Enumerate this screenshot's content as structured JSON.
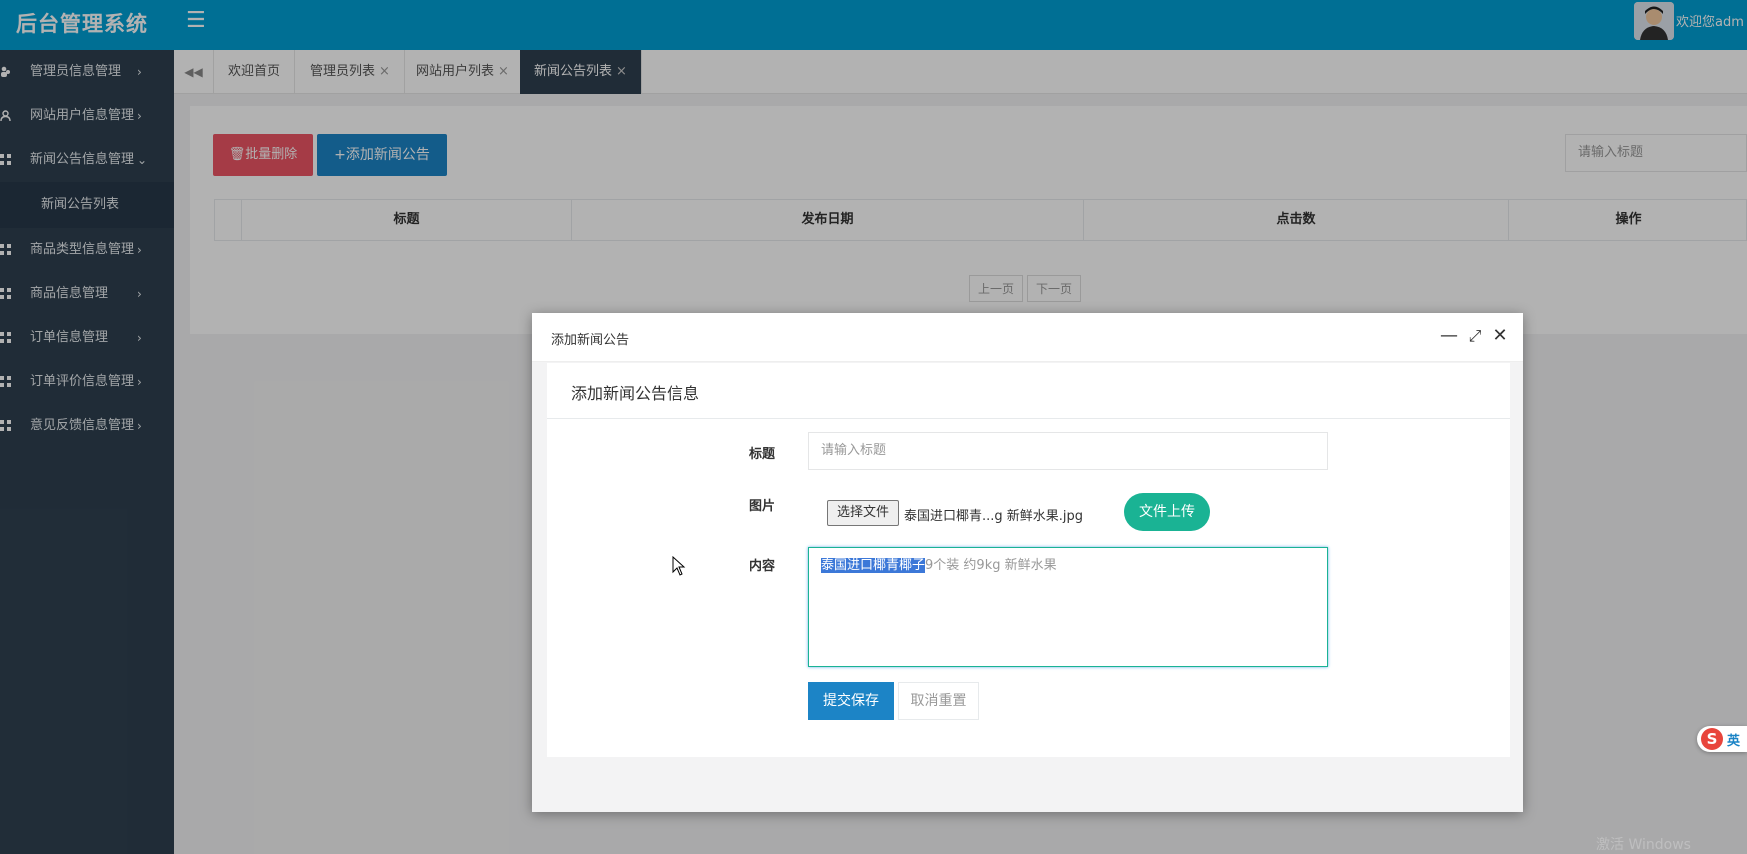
{
  "topbar": {
    "brand": "后台管理系统",
    "menu_icon": "☰",
    "welcome": "欢迎您adm"
  },
  "sidebar": {
    "items": [
      {
        "label": "管理员信息管理",
        "arrow": "›",
        "icon": "users-icon"
      },
      {
        "label": "网站用户信息管理",
        "arrow": "›",
        "icon": "user-icon"
      },
      {
        "label": "新闻公告信息管理",
        "arrow": "⌄",
        "icon": "grid-icon"
      },
      {
        "label": "新闻公告列表",
        "sub": true
      },
      {
        "label": "商品类型信息管理",
        "arrow": "›",
        "icon": "grid-icon"
      },
      {
        "label": "商品信息管理",
        "arrow": "›",
        "icon": "grid-icon"
      },
      {
        "label": "订单信息管理",
        "arrow": "›",
        "icon": "grid-icon"
      },
      {
        "label": "订单评价信息管理",
        "arrow": "›",
        "icon": "grid-icon"
      },
      {
        "label": "意见反馈信息管理",
        "arrow": "›",
        "icon": "grid-icon"
      }
    ]
  },
  "tabs": {
    "back_icon": "◀◀",
    "items": [
      {
        "label": "欢迎首页",
        "close": ""
      },
      {
        "label": "管理员列表",
        "close": "×"
      },
      {
        "label": "网站用户列表",
        "close": "×"
      },
      {
        "label": "新闻公告列表",
        "close": "×",
        "active": true
      }
    ]
  },
  "toolbar": {
    "batch_delete": "批量删除",
    "add_news": "+添加新闻公告",
    "search_placeholder": "请输入标题"
  },
  "table": {
    "columns": [
      "标题",
      "发布日期",
      "点击数",
      "操作"
    ]
  },
  "pager": {
    "prev": "上一页",
    "next": "下一页"
  },
  "modal": {
    "title": "添加新闻公告",
    "minimize": "—",
    "maximize": "⤢",
    "close": "✕",
    "form_title": "添加新闻公告信息",
    "title_label": "标题",
    "title_placeholder": "请输入标题",
    "image_label": "图片",
    "choose_file": "选择文件",
    "file_name": "泰国进口椰青...g 新鲜水果.jpg",
    "upload": "文件上传",
    "content_label": "内容",
    "content_selected": "泰国进口椰青椰子",
    "content_rest": "9个装 约9kg 新鲜水果",
    "submit": "提交保存",
    "reset": "取消重置"
  },
  "ime": {
    "logo": "S",
    "lang": "英"
  },
  "watermark": "激活 Windows",
  "colors": {
    "topbar": "#009fd5",
    "sidebar": "#2f4050",
    "primary": "#1c84c6",
    "danger": "#ed5565",
    "success": "#1ab394"
  }
}
